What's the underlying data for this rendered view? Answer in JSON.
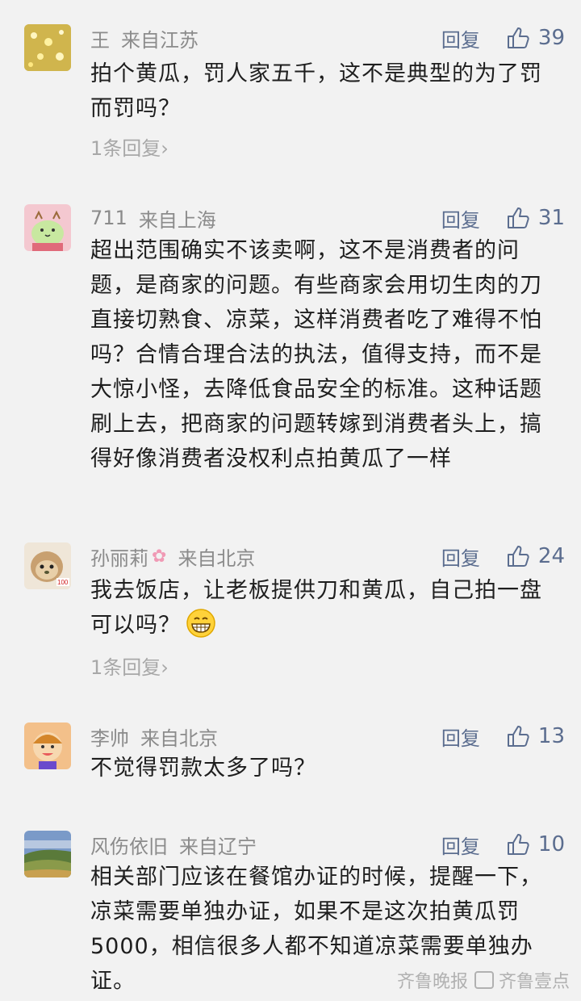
{
  "comments": [
    {
      "name": "王",
      "location": "来自江苏",
      "reply_label": "回复",
      "likes": "39",
      "text": "拍个黄瓜，罚人家五千，这不是典型的为了罚而罚吗？",
      "replies": "1条回复"
    },
    {
      "name": "711",
      "location": "来自上海",
      "reply_label": "回复",
      "likes": "31",
      "text": "超出范围确实不该卖啊，这不是消费者的问题，是商家的问题。有些商家会用切生肉的刀直接切熟食、凉菜，这样消费者吃了难得不怕吗？合情合理合法的执法，值得支持，而不是大惊小怪，去降低食品安全的标准。这种话题刷上去，把商家的问题转嫁到消费者头上，搞得好像消费者没权利点拍黄瓜了一样"
    },
    {
      "name": "孙丽莉",
      "location": "来自北京",
      "reply_label": "回复",
      "likes": "24",
      "text": "我去饭店，让老板提供刀和黄瓜，自己拍一盘可以吗？",
      "replies": "1条回复"
    },
    {
      "name": "李帅",
      "location": "来自北京",
      "reply_label": "回复",
      "likes": "13",
      "text": "不觉得罚款太多了吗？"
    },
    {
      "name": "风伤依旧",
      "location": "来自辽宁",
      "reply_label": "回复",
      "likes": "10",
      "text": "相关部门应该在餐馆办证的时候，提醒一下，凉菜需要单独办证，如果不是这次拍黄瓜罚5000，相信很多人都不知道凉菜需要单独办证。"
    }
  ],
  "watermark": {
    "brand1": "齐鲁晚报",
    "brand2": "齐鲁壹点"
  },
  "icons": {
    "like": "thumbs-up-icon",
    "chevron": "chevron-right-icon",
    "emoji": "grinning-face-icon",
    "flower": "cherry-blossom-icon"
  },
  "colors": {
    "background": "#f2f2f2",
    "meta_gray": "#8b8b8b",
    "action_blue": "#5b6d8f",
    "text": "#1e1e1e"
  }
}
